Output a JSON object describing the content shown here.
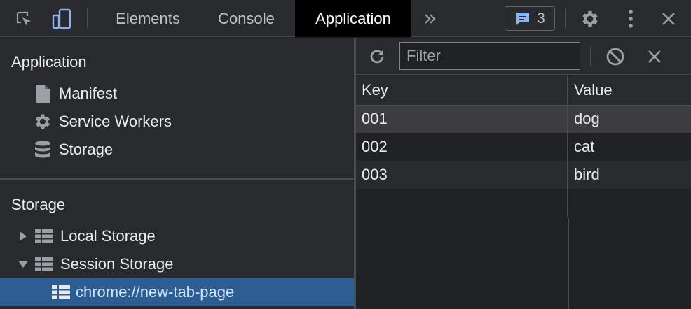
{
  "toolbar": {
    "tabs": [
      {
        "label": "Elements",
        "active": false
      },
      {
        "label": "Console",
        "active": false
      },
      {
        "label": "Application",
        "active": true
      }
    ],
    "more_tabs_icon": "chevron-double-right-icon",
    "issues_count": "3",
    "icons": [
      "inspect-element-icon",
      "device-toolbar-icon",
      "message-icon",
      "gear-icon",
      "kebab-menu-icon",
      "close-icon"
    ]
  },
  "sidebar": {
    "application_section": {
      "title": "Application",
      "items": [
        {
          "label": "Manifest",
          "icon": "file-icon"
        },
        {
          "label": "Service Workers",
          "icon": "gear-icon"
        },
        {
          "label": "Storage",
          "icon": "database-icon"
        }
      ]
    },
    "storage_section": {
      "title": "Storage",
      "items": [
        {
          "label": "Local Storage",
          "icon": "table-icon",
          "expanded": false
        },
        {
          "label": "Session Storage",
          "icon": "table-icon",
          "expanded": true
        },
        {
          "label": "chrome://new-tab-page",
          "icon": "table-icon",
          "selected": true
        }
      ]
    }
  },
  "storage_panel": {
    "filter_placeholder": "Filter",
    "filter_value": "",
    "columns": [
      "Key",
      "Value"
    ],
    "rows": [
      {
        "key": "001",
        "value": "dog"
      },
      {
        "key": "002",
        "value": "cat"
      },
      {
        "key": "003",
        "value": "bird"
      }
    ],
    "selected_row": 0
  },
  "colors": {
    "selection": "#2c5d93",
    "accent": "#8ab4f8",
    "background": "#202124",
    "panel": "#292a2d"
  }
}
